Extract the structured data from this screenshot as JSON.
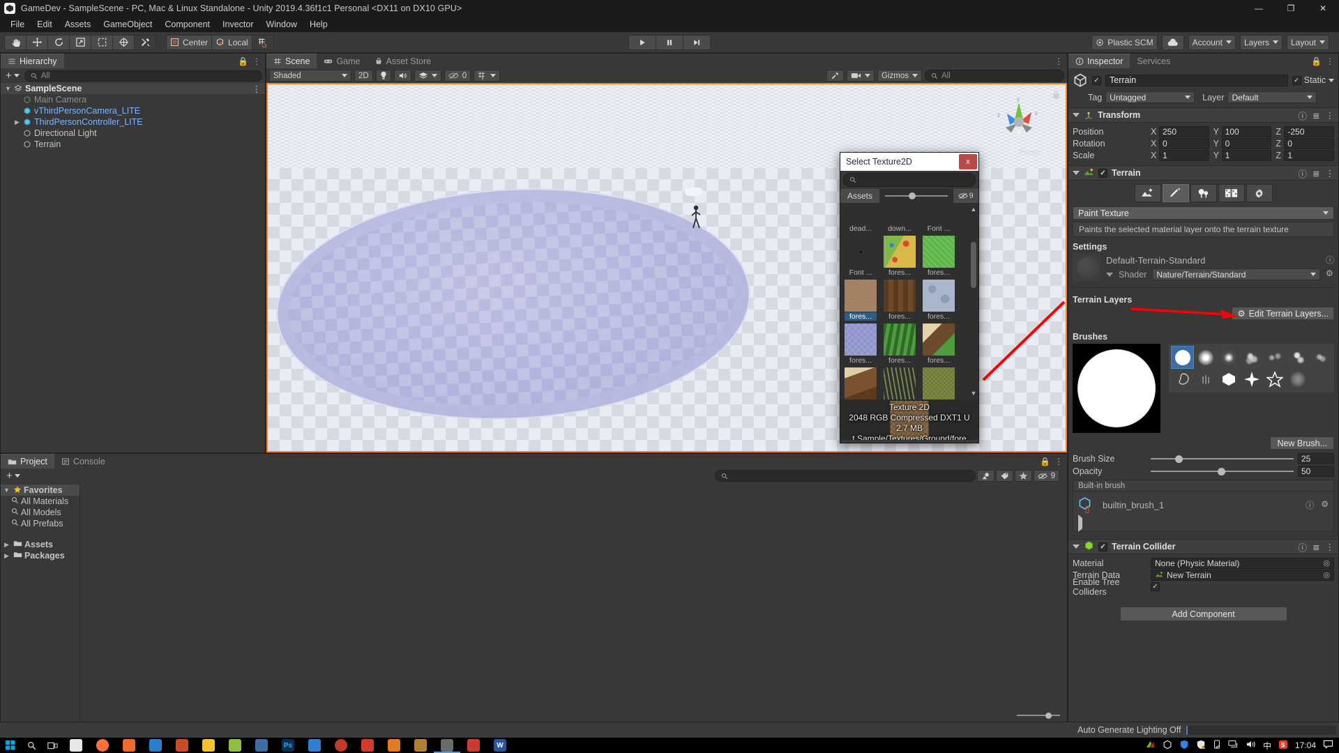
{
  "window": {
    "title": "GameDev - SampleScene - PC, Mac & Linux Standalone - Unity 2019.4.36f1c1 Personal <DX11 on DX10 GPU>",
    "minimize": "—",
    "maximize": "❐",
    "close": "✕"
  },
  "menubar": {
    "items": [
      "File",
      "Edit",
      "Assets",
      "GameObject",
      "Component",
      "Invector",
      "Window",
      "Help"
    ]
  },
  "toolbar": {
    "transform_tools": [
      "hand-tool",
      "move-tool",
      "rotate-tool",
      "scale-tool",
      "rect-tool",
      "transform-tool",
      "custom-editor-tool"
    ],
    "pivot_mode": "Center",
    "pivot_rotation": "Local",
    "grid_snap": "grid-snap-icon",
    "play": "▶",
    "pause": "‖",
    "step": "▶|",
    "collab": "Plastic SCM",
    "cloud": "cloud-icon",
    "account": "Account",
    "layers": "Layers",
    "layout": "Layout"
  },
  "hierarchy": {
    "tab": "Hierarchy",
    "add_label": "+",
    "search_placeholder": "All",
    "items": [
      {
        "label": "SampleScene",
        "depth": 0,
        "kind": "scene",
        "expanded": true,
        "arrow": true
      },
      {
        "label": "Main Camera",
        "depth": 1,
        "kind": "dim",
        "arrow": false
      },
      {
        "label": "vThirdPersonCamera_LITE",
        "depth": 1,
        "kind": "prefab",
        "arrow": false
      },
      {
        "label": "ThirdPersonController_LITE",
        "depth": 1,
        "kind": "prefab",
        "arrow": true
      },
      {
        "label": "Directional Light",
        "depth": 1,
        "kind": "normal",
        "arrow": false
      },
      {
        "label": "Terrain",
        "depth": 1,
        "kind": "normal",
        "arrow": false
      }
    ]
  },
  "sceneview": {
    "tabs": [
      {
        "label": "Scene",
        "icon": "grid-icon",
        "active": true
      },
      {
        "label": "Game",
        "icon": "gamepad-icon",
        "active": false
      },
      {
        "label": "Asset Store",
        "icon": "store-icon",
        "active": false
      }
    ],
    "draw_mode": "Shaded",
    "two_d": "2D",
    "lighting": "light-bulb-icon",
    "audio": "speaker-icon",
    "fx": "fx-icon",
    "hidden_count": "0",
    "grid": "grid-visibility-icon",
    "gizmos": "Gizmos",
    "search_placeholder": "All",
    "perspective_label": "Persp",
    "gizmo_axes": [
      "x",
      "y",
      "z"
    ]
  },
  "texture_dialog": {
    "title": "Select Texture2D",
    "close_label": "x",
    "search_placeholder": "",
    "tab": "Assets",
    "eye_count": "9",
    "rows": [
      [
        {
          "name": "dead...",
          "color": "none",
          "selected": false,
          "empty": true
        },
        {
          "name": "down...",
          "color": "none",
          "selected": false,
          "empty": true
        },
        {
          "name": "Font ...",
          "color": "none",
          "selected": false,
          "empty": true
        }
      ],
      [
        {
          "name": "Font ...",
          "color": "#2f2f2f",
          "selected": false,
          "empty": true
        },
        {
          "name": "fores...",
          "color": "#c9a93d",
          "selected": false,
          "empty": false
        },
        {
          "name": "fores...",
          "color": "#66bb52",
          "selected": false,
          "empty": false
        }
      ],
      [
        {
          "name": "fores...",
          "color": "#9c7b5e",
          "selected": true,
          "empty": false
        },
        {
          "name": "fores...",
          "color": "#6b4326",
          "selected": false,
          "empty": false
        },
        {
          "name": "fores...",
          "color": "#aab6cb",
          "selected": false,
          "empty": false
        }
      ],
      [
        {
          "name": "fores...",
          "color": "#8e93c9",
          "selected": false,
          "empty": false
        },
        {
          "name": "fores...",
          "color": "#3f7a33",
          "selected": false,
          "empty": false
        },
        {
          "name": "fores...",
          "color": "#6c4b2c",
          "selected": false,
          "empty": false
        }
      ],
      [
        {
          "name": "",
          "color": "#7b5230",
          "selected": false,
          "empty": false
        },
        {
          "name": "",
          "color": "#434a3a",
          "selected": false,
          "empty": false
        },
        {
          "name": "",
          "color": "#6f7a3a",
          "selected": false,
          "empty": false
        }
      ]
    ],
    "preview": {
      "type": "Texture 2D",
      "specs": "2048  RGB Compressed DXT1 U",
      "size": "2.7 MB",
      "path": "t Sample/Textures/Ground/fore"
    }
  },
  "inspector": {
    "tabs": [
      {
        "label": "Inspector",
        "active": true,
        "icon": "info-icon"
      },
      {
        "label": "Services",
        "active": false,
        "icon": ""
      }
    ],
    "object": {
      "name": "Terrain",
      "enabled": true,
      "static_label": "Static",
      "static_checked": true,
      "tag_label": "Tag",
      "tag_value": "Untagged",
      "layer_label": "Layer",
      "layer_value": "Default"
    },
    "transform": {
      "title": "Transform",
      "rows": [
        {
          "label": "Position",
          "x": "250",
          "y": "100",
          "z": "-250"
        },
        {
          "label": "Rotation",
          "x": "0",
          "y": "0",
          "z": "0"
        },
        {
          "label": "Scale",
          "x": "1",
          "y": "1",
          "z": "1"
        }
      ],
      "axes": [
        "X",
        "Y",
        "Z"
      ]
    },
    "terrain": {
      "title": "Terrain",
      "enabled": true,
      "tools": [
        {
          "name": "raise-lower-terrain-tool",
          "active": false
        },
        {
          "name": "paint-texture-tool",
          "active": true
        },
        {
          "name": "paint-trees-tool",
          "active": false
        },
        {
          "name": "paint-details-tool",
          "active": false
        },
        {
          "name": "terrain-settings-tool",
          "active": false
        }
      ],
      "mode": "Paint Texture",
      "help": "Paints the selected material layer onto the terrain texture",
      "settings_title": "Settings",
      "material_name": "Default-Terrain-Standard",
      "shader_label": "Shader",
      "shader_value": "Nature/Terrain/Standard",
      "layers_title": "Terrain Layers",
      "edit_layers_btn": "Edit Terrain Layers...",
      "brushes_title": "Brushes",
      "new_brush_btn": "New Brush...",
      "brush_size_label": "Brush Size",
      "brush_size_value": "25",
      "opacity_label": "Opacity",
      "opacity_value": "50",
      "builtin_label": "Built-in brush",
      "builtin_asset": "builtin_brush_1"
    },
    "terrain_collider": {
      "title": "Terrain Collider",
      "enabled": true,
      "material_label": "Material",
      "material_value": "None (Physic Material)",
      "terrain_data_label": "Terrain Data",
      "terrain_data_value": "New Terrain",
      "tree_colliders_label": "Enable Tree Colliders",
      "tree_colliders_checked": true
    },
    "add_component": "Add Component"
  },
  "project": {
    "tabs": [
      {
        "label": "Project",
        "active": true,
        "icon": "folder-icon"
      },
      {
        "label": "Console",
        "active": false,
        "icon": "console-icon"
      }
    ],
    "add_label": "+",
    "search_placeholder": "",
    "tree": [
      {
        "label": "Favorites",
        "kind": "favorites",
        "arrow": "down",
        "selected": true
      },
      {
        "label": "All Materials",
        "kind": "search",
        "arrow": "none",
        "selected": false
      },
      {
        "label": "All Models",
        "kind": "search",
        "arrow": "none",
        "selected": false
      },
      {
        "label": "All Prefabs",
        "kind": "search",
        "arrow": "none",
        "selected": false
      },
      {
        "label": "Assets",
        "kind": "folder",
        "arrow": "right",
        "selected": false
      },
      {
        "label": "Packages",
        "kind": "folder",
        "arrow": "right",
        "selected": false
      }
    ],
    "filter_icons": [
      "asset-type-filter-icon",
      "label-filter-icon",
      "favorite-filter-icon"
    ],
    "eye_count": "9"
  },
  "statusbar": {
    "text": "Auto Generate Lighting Off"
  },
  "taskbar": {
    "start": "start-icon",
    "search": "search-icon",
    "taskview": "task-view-icon",
    "apps": [
      {
        "name": "chrome-icon",
        "color": "#e8e8e8",
        "glyph": ""
      },
      {
        "name": "firefox-icon",
        "color": "#ff7139",
        "glyph": ""
      },
      {
        "name": "editor-icon",
        "color": "#f06a2a",
        "glyph": ""
      },
      {
        "name": "vscode-icon",
        "color": "#2a7fc9",
        "glyph": ""
      },
      {
        "name": "office-icon",
        "color": "#c94b2a",
        "glyph": ""
      },
      {
        "name": "explorer-icon",
        "color": "#f4c430",
        "glyph": ""
      },
      {
        "name": "tool-icon",
        "color": "#8fbf3f",
        "glyph": ""
      },
      {
        "name": "player-icon",
        "color": "#3b6ea5",
        "glyph": ""
      },
      {
        "name": "photoshop-icon",
        "color": "#0a2f52",
        "glyph": "Ps"
      },
      {
        "name": "mail-icon",
        "color": "#2f7fd0",
        "glyph": ""
      },
      {
        "name": "disc-icon",
        "color": "#c03a2b",
        "glyph": ""
      },
      {
        "name": "red-app-icon",
        "color": "#d33a2c",
        "glyph": ""
      },
      {
        "name": "orange-app-icon",
        "color": "#e07b20",
        "glyph": ""
      },
      {
        "name": "folder-app-icon",
        "color": "#b08030",
        "glyph": ""
      },
      {
        "name": "unity-icon",
        "color": "#6b6b6b",
        "glyph": ""
      },
      {
        "name": "red-doc-icon",
        "color": "#cc3b30",
        "glyph": ""
      },
      {
        "name": "word-icon",
        "color": "#2b579a",
        "glyph": "W"
      }
    ],
    "tray": [
      "nvidia-icon",
      "unity-hub-icon",
      "shield-icon",
      "security-icon",
      "usb-icon",
      "network-icon",
      "volume-icon",
      "ime-icon",
      "snipping-icon"
    ],
    "ime": "中",
    "clock": "17:04",
    "notifications": "notification-icon"
  }
}
